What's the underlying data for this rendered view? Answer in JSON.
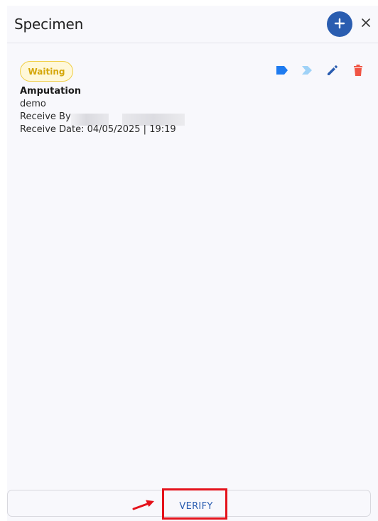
{
  "header": {
    "title": "Specimen"
  },
  "card": {
    "status": "Waiting",
    "name": "Amputation",
    "subtitle": "demo",
    "receive_by_label": "Receive By:",
    "receive_date_label": "Receive Date:",
    "receive_date_value": "04/05/2025 | 19:19"
  },
  "footer": {
    "verify_label": "VERIFY"
  },
  "colors": {
    "primary": "#2a5db0",
    "label_icon": "#1e7bf0",
    "next_icon": "#9fd2f7",
    "delete_icon": "#f05545",
    "waiting_badge_text": "#d5a70b",
    "waiting_badge_border": "#f0cf48",
    "highlight_box": "#e4121b"
  },
  "icons": {
    "add": "plus-icon",
    "close": "close-icon",
    "label": "label-icon",
    "next": "chevron-right-icon",
    "edit": "pencil-icon",
    "delete": "trash-icon"
  }
}
